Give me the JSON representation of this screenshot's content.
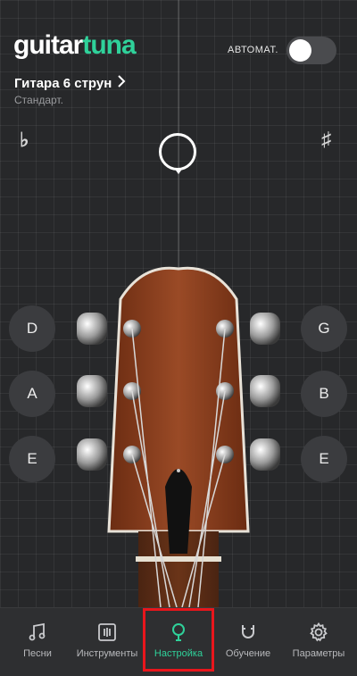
{
  "app": {
    "logo_part1": "guitar",
    "logo_part2": "tuna"
  },
  "header": {
    "auto_label": "АВТОМАТ.",
    "auto_enabled": false
  },
  "instrument": {
    "name": "Гитара 6 струн",
    "tuning": "Стандарт."
  },
  "tuner": {
    "flat_symbol": "♭",
    "sharp_symbol": "♯"
  },
  "strings": {
    "left": [
      "D",
      "A",
      "E"
    ],
    "right": [
      "G",
      "B",
      "E"
    ]
  },
  "tabs": [
    {
      "label": "Песни",
      "icon": "music-note-icon"
    },
    {
      "label": "Инструменты",
      "icon": "chord-chart-icon"
    },
    {
      "label": "Настройка",
      "icon": "tuner-icon",
      "active": true
    },
    {
      "label": "Обучение",
      "icon": "magnet-icon"
    },
    {
      "label": "Параметры",
      "icon": "gear-icon"
    }
  ],
  "colors": {
    "accent": "#2fd19a",
    "highlight": "#e8161c",
    "background": "#27282a"
  }
}
